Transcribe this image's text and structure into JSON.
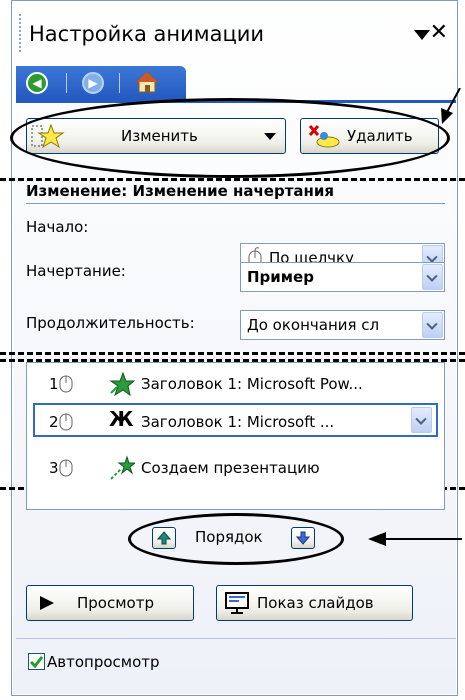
{
  "pane": {
    "title": "Настройка анимации",
    "close_glyph": "✕"
  },
  "nav": {
    "icons": [
      "back-icon",
      "forward-icon",
      "home-icon"
    ]
  },
  "toolbar": {
    "change_label": "Изменить",
    "delete_label": "Удалить"
  },
  "effect": {
    "heading": "Изменение: Изменение начертания",
    "start_label": "Начало:",
    "start_value": "По щелчку",
    "style_label": "Начертание:",
    "style_value": "Пример",
    "duration_label": "Продолжительность:",
    "duration_value": "До окончания сл"
  },
  "effects_list": {
    "items": [
      {
        "num": "1",
        "text": "Заголовок 1: Microsoft Pow..."
      },
      {
        "num": "2",
        "text": "Заголовок 1: Microsoft ..."
      },
      {
        "num": "3",
        "text": "Создаем презентацию"
      }
    ],
    "selected_index": 1
  },
  "order": {
    "label": "Порядок"
  },
  "footer": {
    "preview_label": "Просмотр",
    "slideshow_label": "Показ слайдов",
    "autopreview_label": "Автопросмотр",
    "autopreview_checked": true
  },
  "colors": {
    "nav_bar": "#2459c0",
    "selection_border": "#316ac5",
    "checkbox_check": "#21a121"
  }
}
